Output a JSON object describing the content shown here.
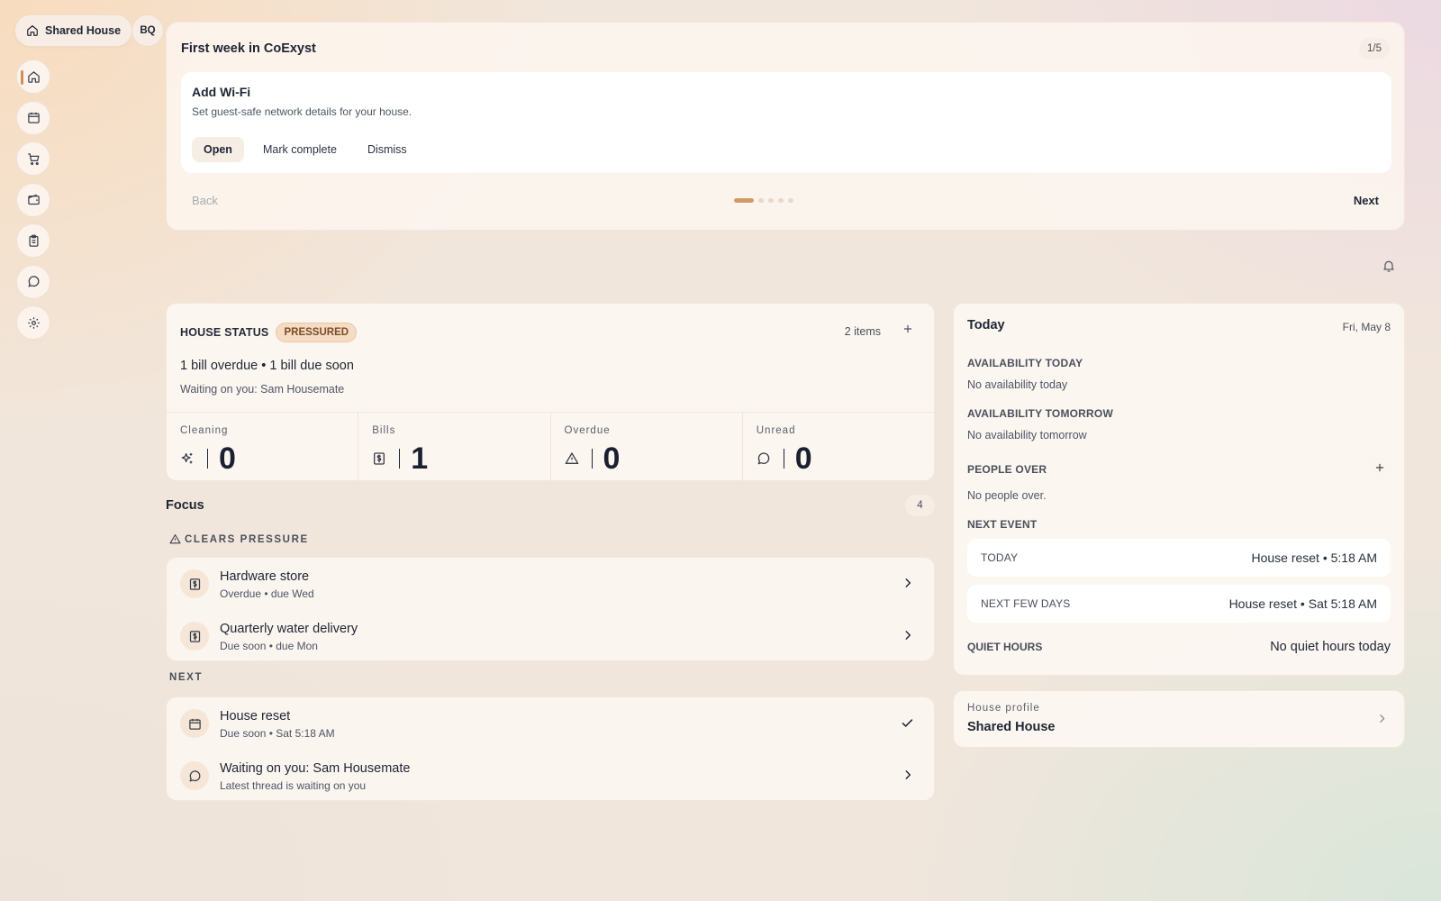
{
  "app": {
    "house_name": "Shared House",
    "user_initials": "BQ",
    "accent_color": "#d98c52",
    "nav": [
      {
        "name": "home",
        "icon": "home-icon",
        "active": true
      },
      {
        "name": "calendar",
        "icon": "calendar-icon",
        "active": false
      },
      {
        "name": "shopping",
        "icon": "cart-icon",
        "active": false
      },
      {
        "name": "wallet",
        "icon": "wallet-icon",
        "active": false
      },
      {
        "name": "tasks",
        "icon": "clipboard-icon",
        "active": false
      },
      {
        "name": "messages",
        "icon": "chat-icon",
        "active": false
      },
      {
        "name": "settings",
        "icon": "gear-icon",
        "active": false
      }
    ]
  },
  "onboarding": {
    "title": "First week in CoExyst",
    "step": "1/5",
    "task_title": "Add Wi-Fi",
    "task_subtitle": "Set guest-safe network details for your house.",
    "actions": {
      "open": "Open",
      "complete": "Mark complete",
      "dismiss": "Dismiss"
    },
    "back": "Back",
    "next": "Next",
    "progress": {
      "current": 1,
      "total": 5
    }
  },
  "house_status": {
    "label": "HOUSE STATUS",
    "badge": "PRESSURED",
    "items": "2 items",
    "summary": "1 bill overdue • 1 bill due soon",
    "waiting": "Waiting on you: Sam Housemate",
    "metrics": [
      {
        "label": "Cleaning",
        "value": "0",
        "icon": "sparkle-icon"
      },
      {
        "label": "Bills",
        "value": "1",
        "icon": "bill-icon"
      },
      {
        "label": "Overdue",
        "value": "0",
        "icon": "warning-icon"
      },
      {
        "label": "Unread",
        "value": "0",
        "icon": "chat-icon"
      }
    ]
  },
  "focus": {
    "title": "Focus",
    "count": "4",
    "clears_label": "CLEARS PRESSURE",
    "next_label": "NEXT",
    "clears": [
      {
        "title": "Hardware store",
        "subtitle": "Overdue • due Wed",
        "icon": "bill-icon"
      },
      {
        "title": "Quarterly water delivery",
        "subtitle": "Due soon • due Mon",
        "icon": "bill-icon"
      }
    ],
    "next": [
      {
        "title": "House reset",
        "subtitle": "Due soon • Sat 5:18 AM",
        "icon": "calendar-icon",
        "action": "check-icon"
      },
      {
        "title": "Waiting on you: Sam Housemate",
        "subtitle": "Latest thread is waiting on you",
        "icon": "chat-icon",
        "action": "chevron-right-icon"
      }
    ]
  },
  "today": {
    "title": "Today",
    "date": "Fri, May 8",
    "availability_today_label": "AVAILABILITY TODAY",
    "availability_today": "No availability today",
    "availability_tomorrow_label": "AVAILABILITY TOMORROW",
    "availability_tomorrow": "No availability tomorrow",
    "people_over_label": "PEOPLE OVER",
    "people_over": "No people over.",
    "next_event_label": "NEXT EVENT",
    "events": [
      {
        "when": "TODAY",
        "what": "House reset • 5:18 AM"
      },
      {
        "when": "NEXT FEW DAYS",
        "what": "House reset • Sat 5:18 AM"
      }
    ],
    "quiet_hours_label": "QUIET HOURS",
    "quiet_hours": "No quiet hours today"
  },
  "house_profile": {
    "label": "House profile",
    "name": "Shared House"
  }
}
